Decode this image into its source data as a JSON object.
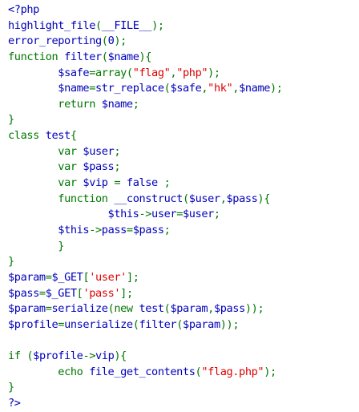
{
  "colors": {
    "default": "#0000BB",
    "keyword": "#007700",
    "string": "#DD0000",
    "comment": "#FF8000",
    "html": "#000000",
    "background": "#FFFFFF"
  },
  "code": {
    "lines": [
      [
        {
          "t": "<?php",
          "k": "default"
        }
      ],
      [
        {
          "t": "highlight_file",
          "k": "default"
        },
        {
          "t": "(",
          "k": "keyword"
        },
        {
          "t": "__FILE__",
          "k": "default"
        },
        {
          "t": ");",
          "k": "keyword"
        }
      ],
      [
        {
          "t": "error_reporting",
          "k": "default"
        },
        {
          "t": "(",
          "k": "keyword"
        },
        {
          "t": "0",
          "k": "default"
        },
        {
          "t": ");",
          "k": "keyword"
        }
      ],
      [
        {
          "t": "function ",
          "k": "keyword"
        },
        {
          "t": "filter",
          "k": "default"
        },
        {
          "t": "(",
          "k": "keyword"
        },
        {
          "t": "$name",
          "k": "default"
        },
        {
          "t": "){",
          "k": "keyword"
        }
      ],
      [
        {
          "t": "        ",
          "k": "html"
        },
        {
          "t": "$safe",
          "k": "default"
        },
        {
          "t": "=array(",
          "k": "keyword"
        },
        {
          "t": "\"flag\"",
          "k": "string"
        },
        {
          "t": ",",
          "k": "keyword"
        },
        {
          "t": "\"php\"",
          "k": "string"
        },
        {
          "t": ");",
          "k": "keyword"
        }
      ],
      [
        {
          "t": "        ",
          "k": "html"
        },
        {
          "t": "$name",
          "k": "default"
        },
        {
          "t": "=",
          "k": "keyword"
        },
        {
          "t": "str_replace",
          "k": "default"
        },
        {
          "t": "(",
          "k": "keyword"
        },
        {
          "t": "$safe",
          "k": "default"
        },
        {
          "t": ",",
          "k": "keyword"
        },
        {
          "t": "\"hk\"",
          "k": "string"
        },
        {
          "t": ",",
          "k": "keyword"
        },
        {
          "t": "$name",
          "k": "default"
        },
        {
          "t": ");",
          "k": "keyword"
        }
      ],
      [
        {
          "t": "        ",
          "k": "html"
        },
        {
          "t": "return ",
          "k": "keyword"
        },
        {
          "t": "$name",
          "k": "default"
        },
        {
          "t": ";",
          "k": "keyword"
        }
      ],
      [
        {
          "t": "}",
          "k": "keyword"
        }
      ],
      [
        {
          "t": "class ",
          "k": "keyword"
        },
        {
          "t": "test",
          "k": "default"
        },
        {
          "t": "{",
          "k": "keyword"
        }
      ],
      [
        {
          "t": "        ",
          "k": "html"
        },
        {
          "t": "var ",
          "k": "keyword"
        },
        {
          "t": "$user",
          "k": "default"
        },
        {
          "t": ";",
          "k": "keyword"
        }
      ],
      [
        {
          "t": "        ",
          "k": "html"
        },
        {
          "t": "var ",
          "k": "keyword"
        },
        {
          "t": "$pass",
          "k": "default"
        },
        {
          "t": ";",
          "k": "keyword"
        }
      ],
      [
        {
          "t": "        ",
          "k": "html"
        },
        {
          "t": "var ",
          "k": "keyword"
        },
        {
          "t": "$vip ",
          "k": "default"
        },
        {
          "t": "= ",
          "k": "keyword"
        },
        {
          "t": "false ",
          "k": "default"
        },
        {
          "t": ";",
          "k": "keyword"
        }
      ],
      [
        {
          "t": "        ",
          "k": "html"
        },
        {
          "t": "function ",
          "k": "keyword"
        },
        {
          "t": "__construct",
          "k": "default"
        },
        {
          "t": "(",
          "k": "keyword"
        },
        {
          "t": "$user",
          "k": "default"
        },
        {
          "t": ",",
          "k": "keyword"
        },
        {
          "t": "$pass",
          "k": "default"
        },
        {
          "t": "){",
          "k": "keyword"
        }
      ],
      [
        {
          "t": "                ",
          "k": "html"
        },
        {
          "t": "$this",
          "k": "default"
        },
        {
          "t": "->",
          "k": "keyword"
        },
        {
          "t": "user",
          "k": "default"
        },
        {
          "t": "=",
          "k": "keyword"
        },
        {
          "t": "$user",
          "k": "default"
        },
        {
          "t": ";",
          "k": "keyword"
        }
      ],
      [
        {
          "t": "        ",
          "k": "html"
        },
        {
          "t": "$this",
          "k": "default"
        },
        {
          "t": "->",
          "k": "keyword"
        },
        {
          "t": "pass",
          "k": "default"
        },
        {
          "t": "=",
          "k": "keyword"
        },
        {
          "t": "$pass",
          "k": "default"
        },
        {
          "t": ";",
          "k": "keyword"
        }
      ],
      [
        {
          "t": "        ",
          "k": "html"
        },
        {
          "t": "}",
          "k": "keyword"
        }
      ],
      [
        {
          "t": "}",
          "k": "keyword"
        }
      ],
      [
        {
          "t": "$param",
          "k": "default"
        },
        {
          "t": "=",
          "k": "keyword"
        },
        {
          "t": "$_GET",
          "k": "default"
        },
        {
          "t": "[",
          "k": "keyword"
        },
        {
          "t": "'user'",
          "k": "string"
        },
        {
          "t": "];",
          "k": "keyword"
        }
      ],
      [
        {
          "t": "$pass",
          "k": "default"
        },
        {
          "t": "=",
          "k": "keyword"
        },
        {
          "t": "$_GET",
          "k": "default"
        },
        {
          "t": "[",
          "k": "keyword"
        },
        {
          "t": "'pass'",
          "k": "string"
        },
        {
          "t": "];",
          "k": "keyword"
        }
      ],
      [
        {
          "t": "$param",
          "k": "default"
        },
        {
          "t": "=",
          "k": "keyword"
        },
        {
          "t": "serialize",
          "k": "default"
        },
        {
          "t": "(new ",
          "k": "keyword"
        },
        {
          "t": "test",
          "k": "default"
        },
        {
          "t": "(",
          "k": "keyword"
        },
        {
          "t": "$param",
          "k": "default"
        },
        {
          "t": ",",
          "k": "keyword"
        },
        {
          "t": "$pass",
          "k": "default"
        },
        {
          "t": "));",
          "k": "keyword"
        }
      ],
      [
        {
          "t": "$profile",
          "k": "default"
        },
        {
          "t": "=",
          "k": "keyword"
        },
        {
          "t": "unserialize",
          "k": "default"
        },
        {
          "t": "(",
          "k": "keyword"
        },
        {
          "t": "filter",
          "k": "default"
        },
        {
          "t": "(",
          "k": "keyword"
        },
        {
          "t": "$param",
          "k": "default"
        },
        {
          "t": "));",
          "k": "keyword"
        }
      ],
      [],
      [
        {
          "t": "if ",
          "k": "keyword"
        },
        {
          "t": "(",
          "k": "keyword"
        },
        {
          "t": "$profile",
          "k": "default"
        },
        {
          "t": "->",
          "k": "keyword"
        },
        {
          "t": "vip",
          "k": "default"
        },
        {
          "t": "){",
          "k": "keyword"
        }
      ],
      [
        {
          "t": "        ",
          "k": "html"
        },
        {
          "t": "echo ",
          "k": "keyword"
        },
        {
          "t": "file_get_contents",
          "k": "default"
        },
        {
          "t": "(",
          "k": "keyword"
        },
        {
          "t": "\"flag.php\"",
          "k": "string"
        },
        {
          "t": ");",
          "k": "keyword"
        }
      ],
      [
        {
          "t": "}",
          "k": "keyword"
        }
      ],
      [
        {
          "t": "?>",
          "k": "default"
        }
      ]
    ]
  }
}
